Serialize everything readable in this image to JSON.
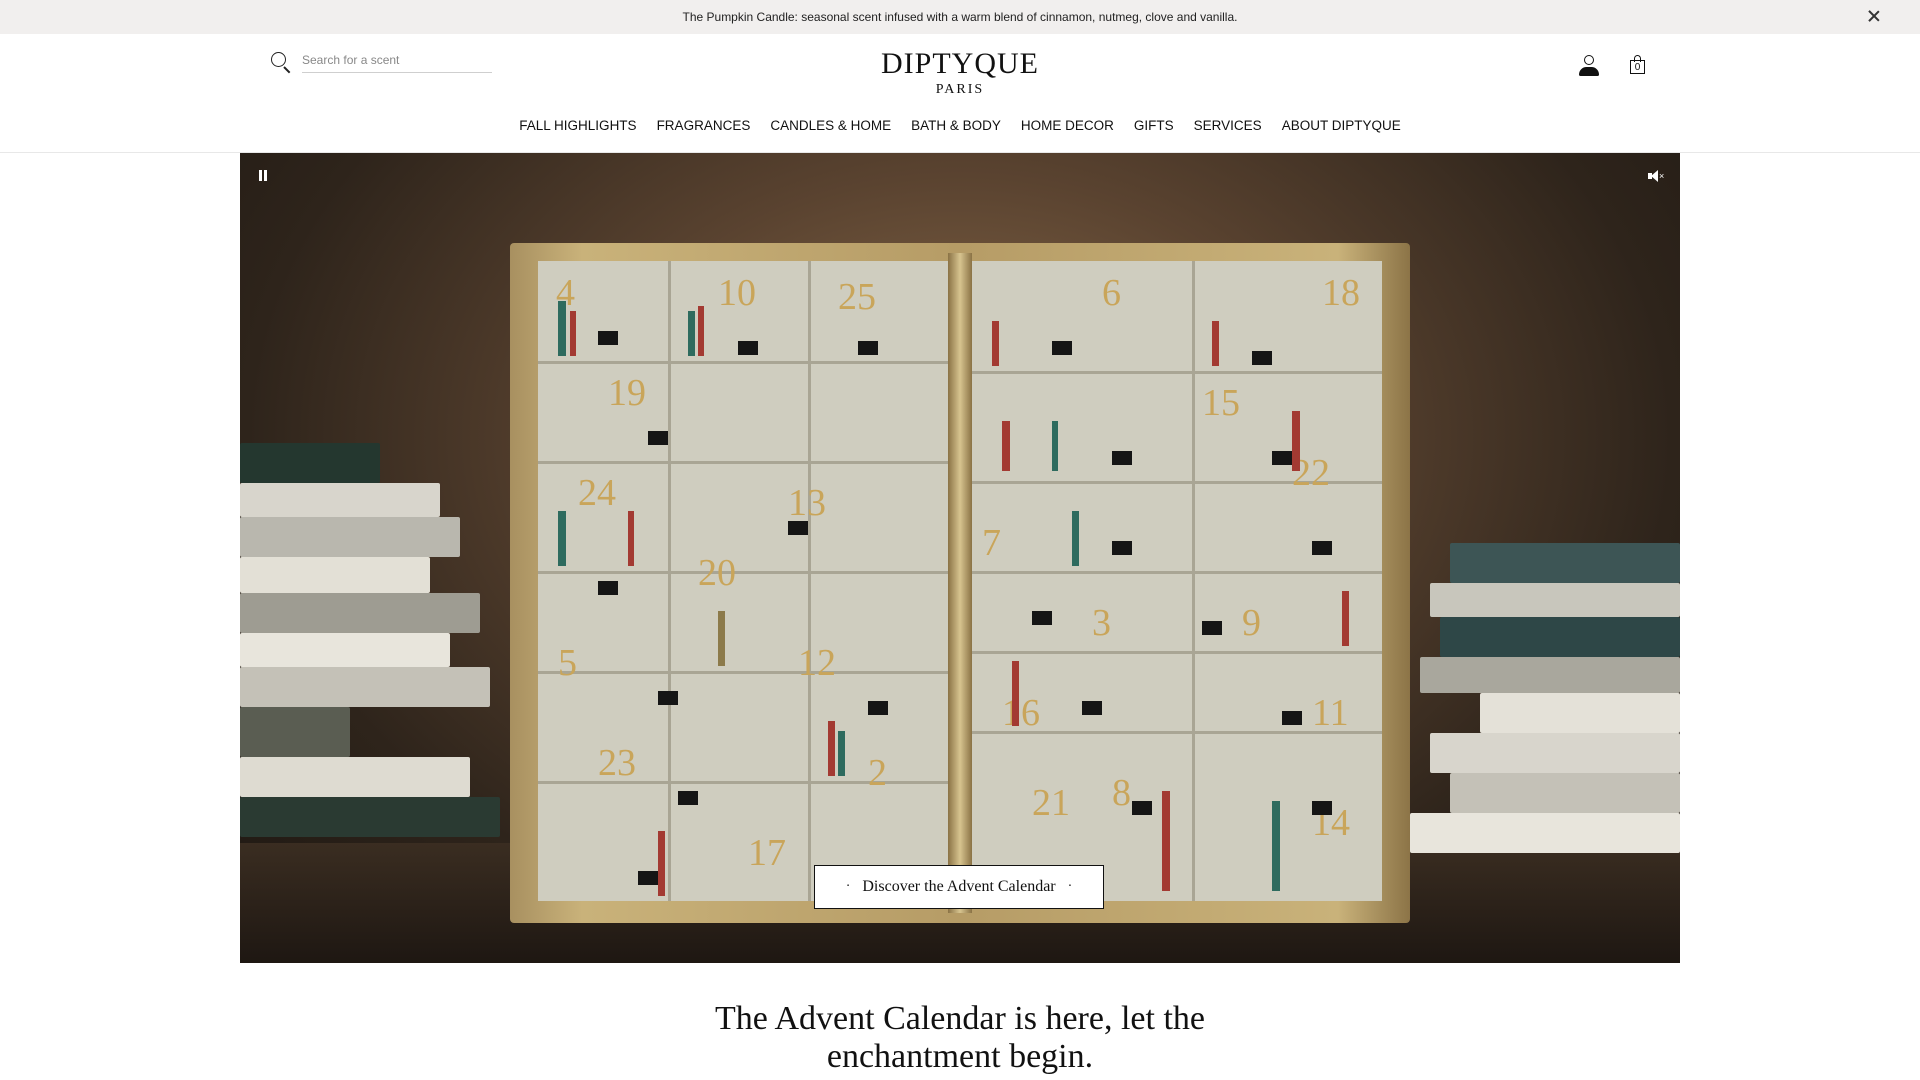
{
  "announcement": {
    "text": "The Pumpkin Candle: seasonal scent infused with a warm blend of cinnamon, nutmeg, clove and vanilla."
  },
  "header": {
    "search_placeholder": "Search for a scent",
    "logo_main": "DIPTYQUE",
    "logo_sub": "PARIS",
    "bag_count": "0"
  },
  "nav": {
    "items": [
      {
        "label": "FALL HIGHLIGHTS"
      },
      {
        "label": "FRAGRANCES"
      },
      {
        "label": "CANDLES & HOME"
      },
      {
        "label": "BATH & BODY"
      },
      {
        "label": "HOME DECOR"
      },
      {
        "label": "GIFTS"
      },
      {
        "label": "SERVICES"
      },
      {
        "label": "ABOUT DIPTYQUE"
      }
    ]
  },
  "hero": {
    "cta_label": "Discover the Advent Calendar",
    "cta_dot": "·",
    "calendar_numbers": [
      "4",
      "10",
      "25",
      "6",
      "18",
      "19",
      "15",
      "24",
      "13",
      "22",
      "20",
      "7",
      "5",
      "12",
      "3",
      "9",
      "16",
      "11",
      "23",
      "2",
      "21",
      "8",
      "17",
      "14"
    ]
  },
  "main": {
    "headline_line1": "The Advent Calendar is here, let the",
    "headline_line2": "enchantment begin."
  }
}
